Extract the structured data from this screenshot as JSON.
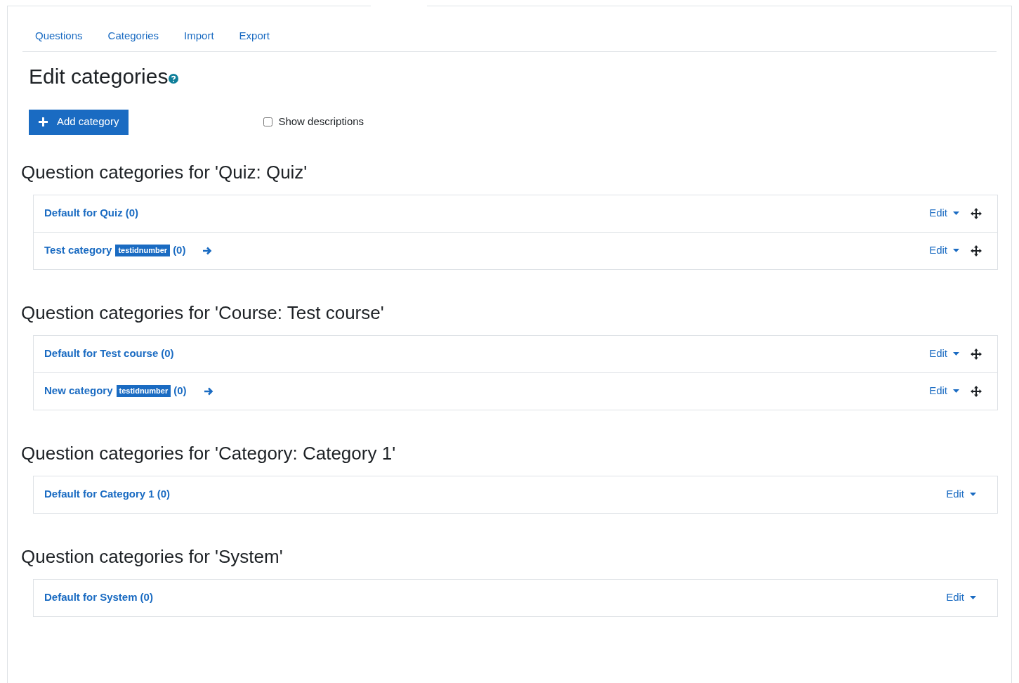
{
  "tabs": [
    {
      "label": "Questions"
    },
    {
      "label": "Categories"
    },
    {
      "label": "Import"
    },
    {
      "label": "Export"
    }
  ],
  "heading": "Edit categories",
  "add_button": "Add category",
  "show_descriptions": {
    "label": "Show descriptions",
    "checked": false
  },
  "sections": [
    {
      "title": "Question categories for 'Quiz: Quiz'",
      "categories": [
        {
          "name": "Default for Quiz",
          "count": "(0)",
          "arrow": false,
          "movable": true,
          "edit": "Edit"
        },
        {
          "name": "Test category",
          "idnumber": "testidnumber",
          "count": "(0)",
          "arrow": true,
          "movable": true,
          "edit": "Edit"
        }
      ]
    },
    {
      "title": "Question categories for 'Course: Test course'",
      "categories": [
        {
          "name": "Default for Test course",
          "count": "(0)",
          "arrow": false,
          "movable": true,
          "edit": "Edit"
        },
        {
          "name": "New category",
          "idnumber": "testidnumber",
          "count": "(0)",
          "arrow": true,
          "movable": true,
          "edit": "Edit"
        }
      ]
    },
    {
      "title": "Question categories for 'Category: Category 1'",
      "categories": [
        {
          "name": "Default for Category 1",
          "count": "(0)",
          "arrow": false,
          "movable": false,
          "edit": "Edit"
        }
      ]
    },
    {
      "title": "Question categories for 'System'",
      "categories": [
        {
          "name": "Default for System",
          "count": "(0)",
          "arrow": false,
          "movable": false,
          "edit": "Edit"
        }
      ]
    }
  ]
}
